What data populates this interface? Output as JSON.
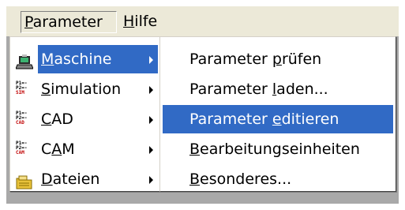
{
  "menubar": {
    "items": [
      {
        "label": "Parameter",
        "mnemonic": "P",
        "rest": "arameter"
      },
      {
        "label": "Hilfe",
        "mnemonic": "H",
        "rest": "ilfe"
      }
    ]
  },
  "main_menu": {
    "items": [
      {
        "label": "Maschine",
        "pre": "",
        "mnemonic": "M",
        "rest": "aschine",
        "icon": "machine-icon",
        "has_submenu": true,
        "active": true
      },
      {
        "label": "Simulation",
        "pre": "",
        "mnemonic": "S",
        "rest": "imulation",
        "icon": "simulation-icon",
        "icon_text": "SIM",
        "has_submenu": true
      },
      {
        "label": "CAD",
        "pre": "",
        "mnemonic": "C",
        "rest": "AD",
        "icon": "cad-icon",
        "icon_text": "CAD",
        "has_submenu": true
      },
      {
        "label": "CAM",
        "pre": "C",
        "mnemonic": "A",
        "rest": "M",
        "icon": "cam-icon",
        "icon_text": "CAM",
        "has_submenu": true
      },
      {
        "label": "Dateien",
        "pre": "",
        "mnemonic": "D",
        "rest": "ateien",
        "icon": "files-icon",
        "has_submenu": true
      }
    ]
  },
  "submenu": {
    "items": [
      {
        "label": "Parameter prüfen",
        "pre": "Parameter ",
        "mnemonic": "p",
        "rest": "rüfen",
        "selected": false
      },
      {
        "label": "Parameter laden...",
        "pre": "Parameter ",
        "mnemonic": "l",
        "rest": "aden...",
        "selected": false
      },
      {
        "label": "Parameter editieren",
        "pre": "Parameter ",
        "mnemonic": "e",
        "rest": "ditieren",
        "selected": true
      },
      {
        "label": "Bearbeitungseinheiten",
        "pre": "",
        "mnemonic": "B",
        "rest": "earbeitungseinheiten",
        "selected": false
      },
      {
        "label": "Besonderes...",
        "pre": "",
        "mnemonic": "B",
        "rest": "esonderes...",
        "selected": false
      }
    ]
  },
  "colors": {
    "highlight": "#316ac5",
    "menubar": "#ece9d8",
    "background": "#a9a9a9"
  }
}
